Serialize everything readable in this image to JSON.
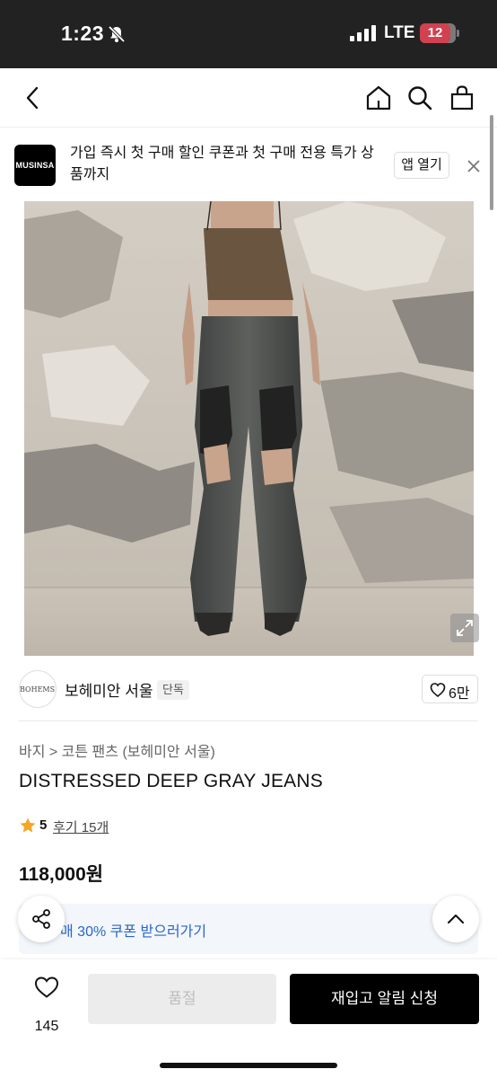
{
  "status_bar": {
    "time": "1:23",
    "network": "LTE",
    "battery": "12"
  },
  "nav": {
    "back_icon": "chevron-left-icon",
    "home_icon": "home-icon",
    "search_icon": "search-icon",
    "bag_icon": "shopping-bag-icon"
  },
  "app_banner": {
    "logo_text": "MUSINSA",
    "message": "가입 즉시 첫 구매 할인 쿠폰과 첫 구매 전용 특가 상품까지",
    "open_label": "앱 열기",
    "close_icon": "close-icon"
  },
  "brand": {
    "avatar_text": "BOHEMSEO",
    "name": "보헤미안 서울",
    "badge": "단독",
    "like_count": "6만"
  },
  "product": {
    "breadcrumb": "바지 > 코튼 팬츠 (보헤미안 서울)",
    "title": "DISTRESSED DEEP GRAY JEANS",
    "rating": "5",
    "review_label": "후기 15개",
    "price": "118,000원",
    "coupon_text": "매 30% 쿠폰 받으러가기"
  },
  "bottom_bar": {
    "wish_count": "145",
    "soldout_label": "품절",
    "restock_label": "재입고 알림 신청"
  },
  "colors": {
    "status_bg": "#222222",
    "battery_red": "#d1414f",
    "coupon_blue": "#2966c8",
    "star_orange": "#f5a623",
    "button_black": "#000000"
  }
}
